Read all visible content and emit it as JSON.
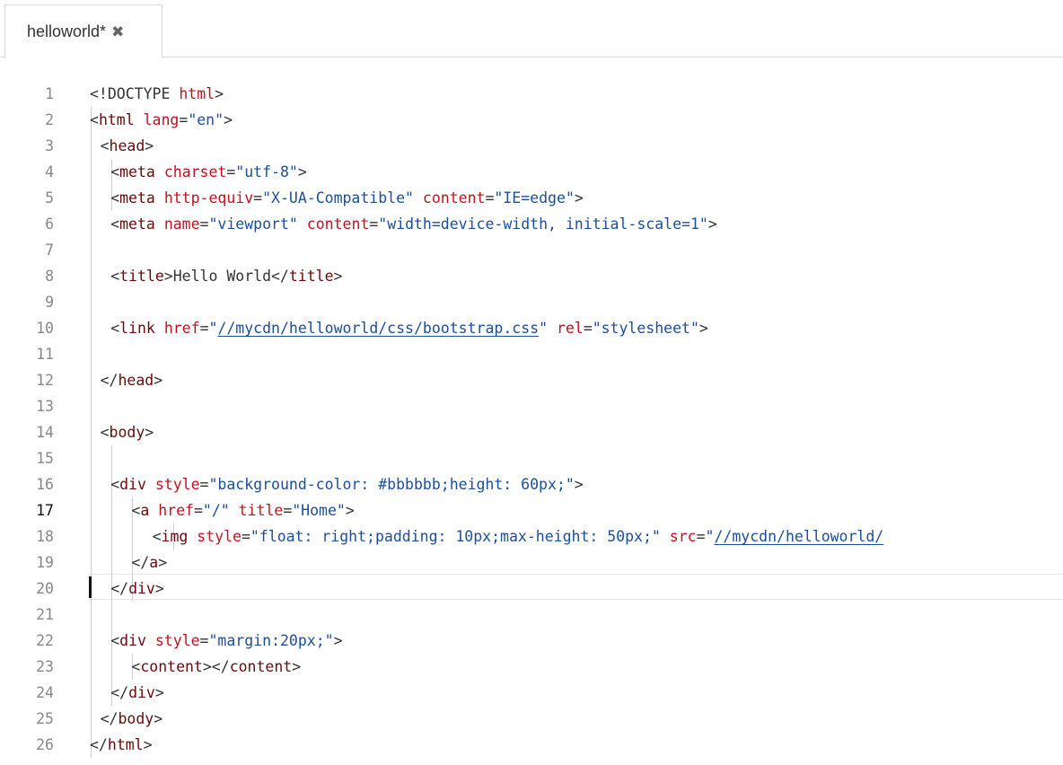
{
  "tab": {
    "title": "helloworld*",
    "close_icon": "close-icon"
  },
  "editor": {
    "active_line": 17,
    "lines": [
      {
        "n": "1",
        "indent": 0,
        "tokens": [
          [
            "punct",
            "<!DOCTYPE "
          ],
          [
            "attr",
            "html"
          ],
          [
            "punct",
            ">"
          ]
        ]
      },
      {
        "n": "2",
        "indent": 0,
        "tokens": [
          [
            "punct",
            "<"
          ],
          [
            "tag",
            "html"
          ],
          [
            "punct",
            " "
          ],
          [
            "attr",
            "lang"
          ],
          [
            "punct",
            "="
          ],
          [
            "str",
            "\"en\""
          ],
          [
            "punct",
            ">"
          ]
        ]
      },
      {
        "n": "3",
        "indent": 1,
        "tokens": [
          [
            "punct",
            "<"
          ],
          [
            "tag",
            "head"
          ],
          [
            "punct",
            ">"
          ]
        ]
      },
      {
        "n": "4",
        "indent": 2,
        "tokens": [
          [
            "punct",
            "<"
          ],
          [
            "tag",
            "meta"
          ],
          [
            "punct",
            " "
          ],
          [
            "attr",
            "charset"
          ],
          [
            "punct",
            "="
          ],
          [
            "str",
            "\"utf-8\""
          ],
          [
            "punct",
            ">"
          ]
        ]
      },
      {
        "n": "5",
        "indent": 2,
        "tokens": [
          [
            "punct",
            "<"
          ],
          [
            "tag",
            "meta"
          ],
          [
            "punct",
            " "
          ],
          [
            "attr",
            "http-equiv"
          ],
          [
            "punct",
            "="
          ],
          [
            "str",
            "\"X-UA-Compatible\""
          ],
          [
            "punct",
            " "
          ],
          [
            "attr",
            "content"
          ],
          [
            "punct",
            "="
          ],
          [
            "str",
            "\"IE=edge\""
          ],
          [
            "punct",
            ">"
          ]
        ]
      },
      {
        "n": "6",
        "indent": 2,
        "tokens": [
          [
            "punct",
            "<"
          ],
          [
            "tag",
            "meta"
          ],
          [
            "punct",
            " "
          ],
          [
            "attr",
            "name"
          ],
          [
            "punct",
            "="
          ],
          [
            "str",
            "\"viewport\""
          ],
          [
            "punct",
            " "
          ],
          [
            "attr",
            "content"
          ],
          [
            "punct",
            "="
          ],
          [
            "str",
            "\"width=device-width, initial-scale=1\""
          ],
          [
            "punct",
            ">"
          ]
        ]
      },
      {
        "n": "7",
        "indent": 0,
        "tokens": []
      },
      {
        "n": "8",
        "indent": 2,
        "tokens": [
          [
            "punct",
            "<"
          ],
          [
            "tag",
            "title"
          ],
          [
            "punct",
            ">Hello World</"
          ],
          [
            "tag",
            "title"
          ],
          [
            "punct",
            ">"
          ]
        ]
      },
      {
        "n": "9",
        "indent": 0,
        "tokens": []
      },
      {
        "n": "10",
        "indent": 2,
        "tokens": [
          [
            "punct",
            "<"
          ],
          [
            "tag",
            "link"
          ],
          [
            "punct",
            " "
          ],
          [
            "attr",
            "href"
          ],
          [
            "punct",
            "="
          ],
          [
            "str",
            "\""
          ],
          [
            "lnk",
            "//mycdn/helloworld/css/bootstrap.css"
          ],
          [
            "str",
            "\""
          ],
          [
            "punct",
            " "
          ],
          [
            "attr",
            "rel"
          ],
          [
            "punct",
            "="
          ],
          [
            "str",
            "\"stylesheet\""
          ],
          [
            "punct",
            ">"
          ]
        ]
      },
      {
        "n": "11",
        "indent": 0,
        "tokens": []
      },
      {
        "n": "12",
        "indent": 1,
        "tokens": [
          [
            "punct",
            "</"
          ],
          [
            "tag",
            "head"
          ],
          [
            "punct",
            ">"
          ]
        ]
      },
      {
        "n": "13",
        "indent": 0,
        "tokens": []
      },
      {
        "n": "14",
        "indent": 1,
        "tokens": [
          [
            "punct",
            "<"
          ],
          [
            "tag",
            "body"
          ],
          [
            "punct",
            ">"
          ]
        ]
      },
      {
        "n": "15",
        "indent": 0,
        "tokens": []
      },
      {
        "n": "16",
        "indent": 2,
        "tokens": [
          [
            "punct",
            "<"
          ],
          [
            "tag",
            "div"
          ],
          [
            "punct",
            " "
          ],
          [
            "attr",
            "style"
          ],
          [
            "punct",
            "="
          ],
          [
            "str",
            "\"background-color: #bbbbbb;height: 60px;\""
          ],
          [
            "punct",
            ">"
          ]
        ]
      },
      {
        "n": "17",
        "indent": 4,
        "tokens": [
          [
            "punct",
            "<"
          ],
          [
            "tag",
            "a"
          ],
          [
            "punct",
            " "
          ],
          [
            "attr",
            "href"
          ],
          [
            "punct",
            "="
          ],
          [
            "str",
            "\"/\""
          ],
          [
            "punct",
            " "
          ],
          [
            "attr",
            "title"
          ],
          [
            "punct",
            "="
          ],
          [
            "str",
            "\"Home\""
          ],
          [
            "punct",
            ">"
          ]
        ]
      },
      {
        "n": "18",
        "indent": 6,
        "tokens": [
          [
            "punct",
            "<"
          ],
          [
            "tag",
            "img"
          ],
          [
            "punct",
            " "
          ],
          [
            "attr",
            "style"
          ],
          [
            "punct",
            "="
          ],
          [
            "str",
            "\"float: right;padding: 10px;max-height: 50px;\""
          ],
          [
            "punct",
            " "
          ],
          [
            "attr",
            "src"
          ],
          [
            "punct",
            "="
          ],
          [
            "str",
            "\""
          ],
          [
            "lnk",
            "//mycdn/helloworld/"
          ]
        ]
      },
      {
        "n": "19",
        "indent": 4,
        "tokens": [
          [
            "punct",
            "</"
          ],
          [
            "tag",
            "a"
          ],
          [
            "punct",
            ">"
          ]
        ]
      },
      {
        "n": "20",
        "indent": 2,
        "tokens": [
          [
            "punct",
            "</"
          ],
          [
            "tag",
            "div"
          ],
          [
            "punct",
            ">"
          ]
        ]
      },
      {
        "n": "21",
        "indent": 0,
        "tokens": []
      },
      {
        "n": "22",
        "indent": 2,
        "tokens": [
          [
            "punct",
            "<"
          ],
          [
            "tag",
            "div"
          ],
          [
            "punct",
            " "
          ],
          [
            "attr",
            "style"
          ],
          [
            "punct",
            "="
          ],
          [
            "str",
            "\"margin:20px;\""
          ],
          [
            "punct",
            ">"
          ]
        ]
      },
      {
        "n": "23",
        "indent": 4,
        "tokens": [
          [
            "punct",
            "<"
          ],
          [
            "tag",
            "content"
          ],
          [
            "punct",
            "></"
          ],
          [
            "tag",
            "content"
          ],
          [
            "punct",
            ">"
          ]
        ]
      },
      {
        "n": "24",
        "indent": 2,
        "tokens": [
          [
            "punct",
            "</"
          ],
          [
            "tag",
            "div"
          ],
          [
            "punct",
            ">"
          ]
        ]
      },
      {
        "n": "25",
        "indent": 1,
        "tokens": [
          [
            "punct",
            "</"
          ],
          [
            "tag",
            "body"
          ],
          [
            "punct",
            ">"
          ]
        ]
      },
      {
        "n": "26",
        "indent": 0,
        "tokens": [
          [
            "punct",
            "</"
          ],
          [
            "tag",
            "html"
          ],
          [
            "punct",
            ">"
          ]
        ]
      }
    ]
  }
}
